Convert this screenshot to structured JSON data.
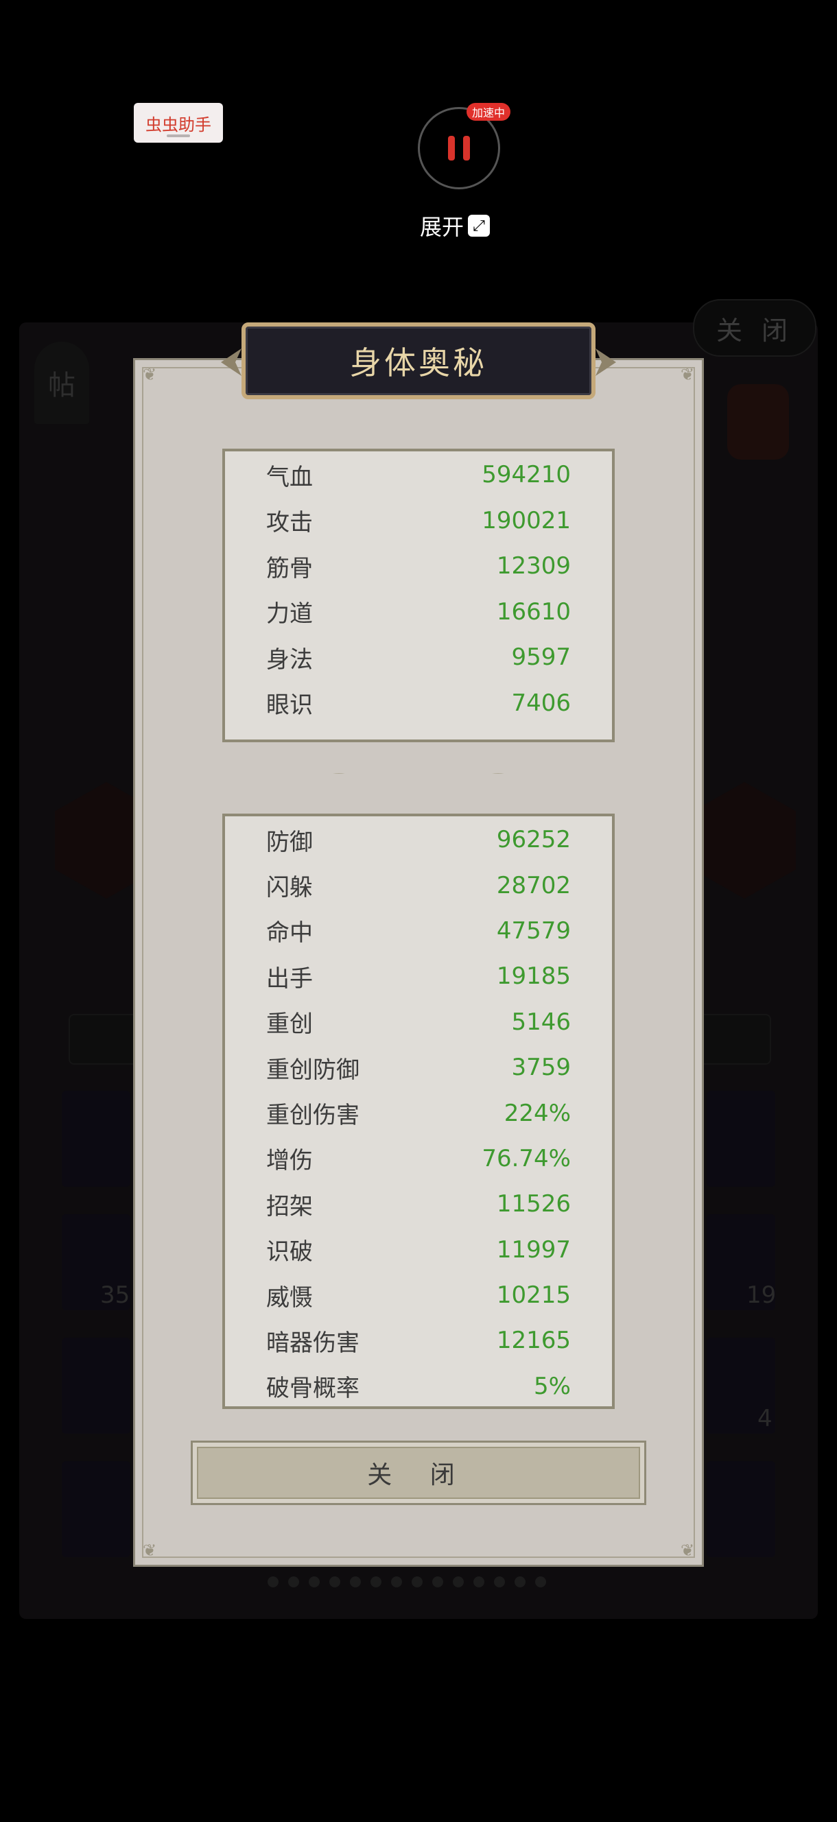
{
  "background": {
    "close_label": "关 闭",
    "post_label": "帖",
    "numbers": [
      "35",
      "19",
      "4"
    ]
  },
  "overlay": {
    "helper_label": "虫虫助手",
    "speed_badge": "加速中",
    "expand_label": "展开"
  },
  "modal": {
    "title": "身体奥秘",
    "basic_stats": [
      {
        "label": "气血",
        "value": "594210"
      },
      {
        "label": "攻击",
        "value": "190021"
      },
      {
        "label": "筋骨",
        "value": "12309"
      },
      {
        "label": "力道",
        "value": "16610"
      },
      {
        "label": "身法",
        "value": "9597"
      },
      {
        "label": "眼识",
        "value": "7406"
      }
    ],
    "combat_stats": [
      {
        "label": "防御",
        "value": "96252"
      },
      {
        "label": "闪躲",
        "value": "28702"
      },
      {
        "label": "命中",
        "value": "47579"
      },
      {
        "label": "出手",
        "value": "19185"
      },
      {
        "label": "重创",
        "value": "5146"
      },
      {
        "label": "重创防御",
        "value": "3759"
      },
      {
        "label": "重创伤害",
        "value": "224%"
      },
      {
        "label": "增伤",
        "value": "76.74%"
      },
      {
        "label": "招架",
        "value": "11526"
      },
      {
        "label": "识破",
        "value": "11997"
      },
      {
        "label": "威慑",
        "value": "10215"
      },
      {
        "label": "暗器伤害",
        "value": "12165"
      },
      {
        "label": "破骨概率",
        "value": "5%"
      }
    ],
    "close_button": "关 闭"
  },
  "colors": {
    "stat_value": "#3e9a2f",
    "title_text": "#e8d6a8",
    "pause_red": "#d9332b"
  }
}
